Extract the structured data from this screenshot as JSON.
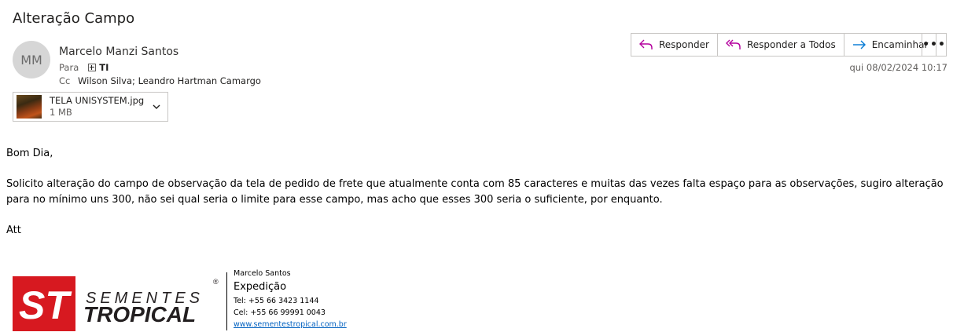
{
  "email": {
    "subject": "Alteração Campo",
    "avatar_initials": "MM",
    "sender": "Marcelo Manzi Santos",
    "to_label": "Para",
    "to_value": "TI",
    "cc_label": "Cc",
    "cc_value": "Wilson Silva; Leandro Hartman Camargo",
    "date": "qui 08/02/2024 10:17"
  },
  "actions": {
    "reply": "Responder",
    "reply_all": "Responder a Todos",
    "forward": "Encaminhar",
    "more": "•••"
  },
  "attachment": {
    "name": "TELA UNISYSTEM.jpg",
    "size": "1 MB"
  },
  "body": {
    "greeting": "Bom Dia,",
    "paragraph": "Solicito alteração do campo de observação da tela de pedido de frete que atualmente conta com 85 caracteres e muitas das vezes falta espaço para as observações, sugiro alteração para no mínimo uns 300, não sei qual seria o limite para esse campo, mas acho que esses 300 seria o suficiente, por enquanto.",
    "closing": "Att"
  },
  "signature": {
    "logo_line1": "SEMENTES",
    "logo_line2": "TROPICAL",
    "logo_mark": "ST",
    "registered": "®",
    "name": "Marcelo Santos",
    "dept": "Expedição",
    "tel": "Tel: +55 66 3423 1144",
    "cel": "Cel: +55 66 99991 0043",
    "website": "www.sementestropical.com.br"
  },
  "colors": {
    "brand_red": "#d71920",
    "brand_dark": "#231f20",
    "reply_icon": "#b4009e",
    "forward_icon": "#0078d4"
  }
}
